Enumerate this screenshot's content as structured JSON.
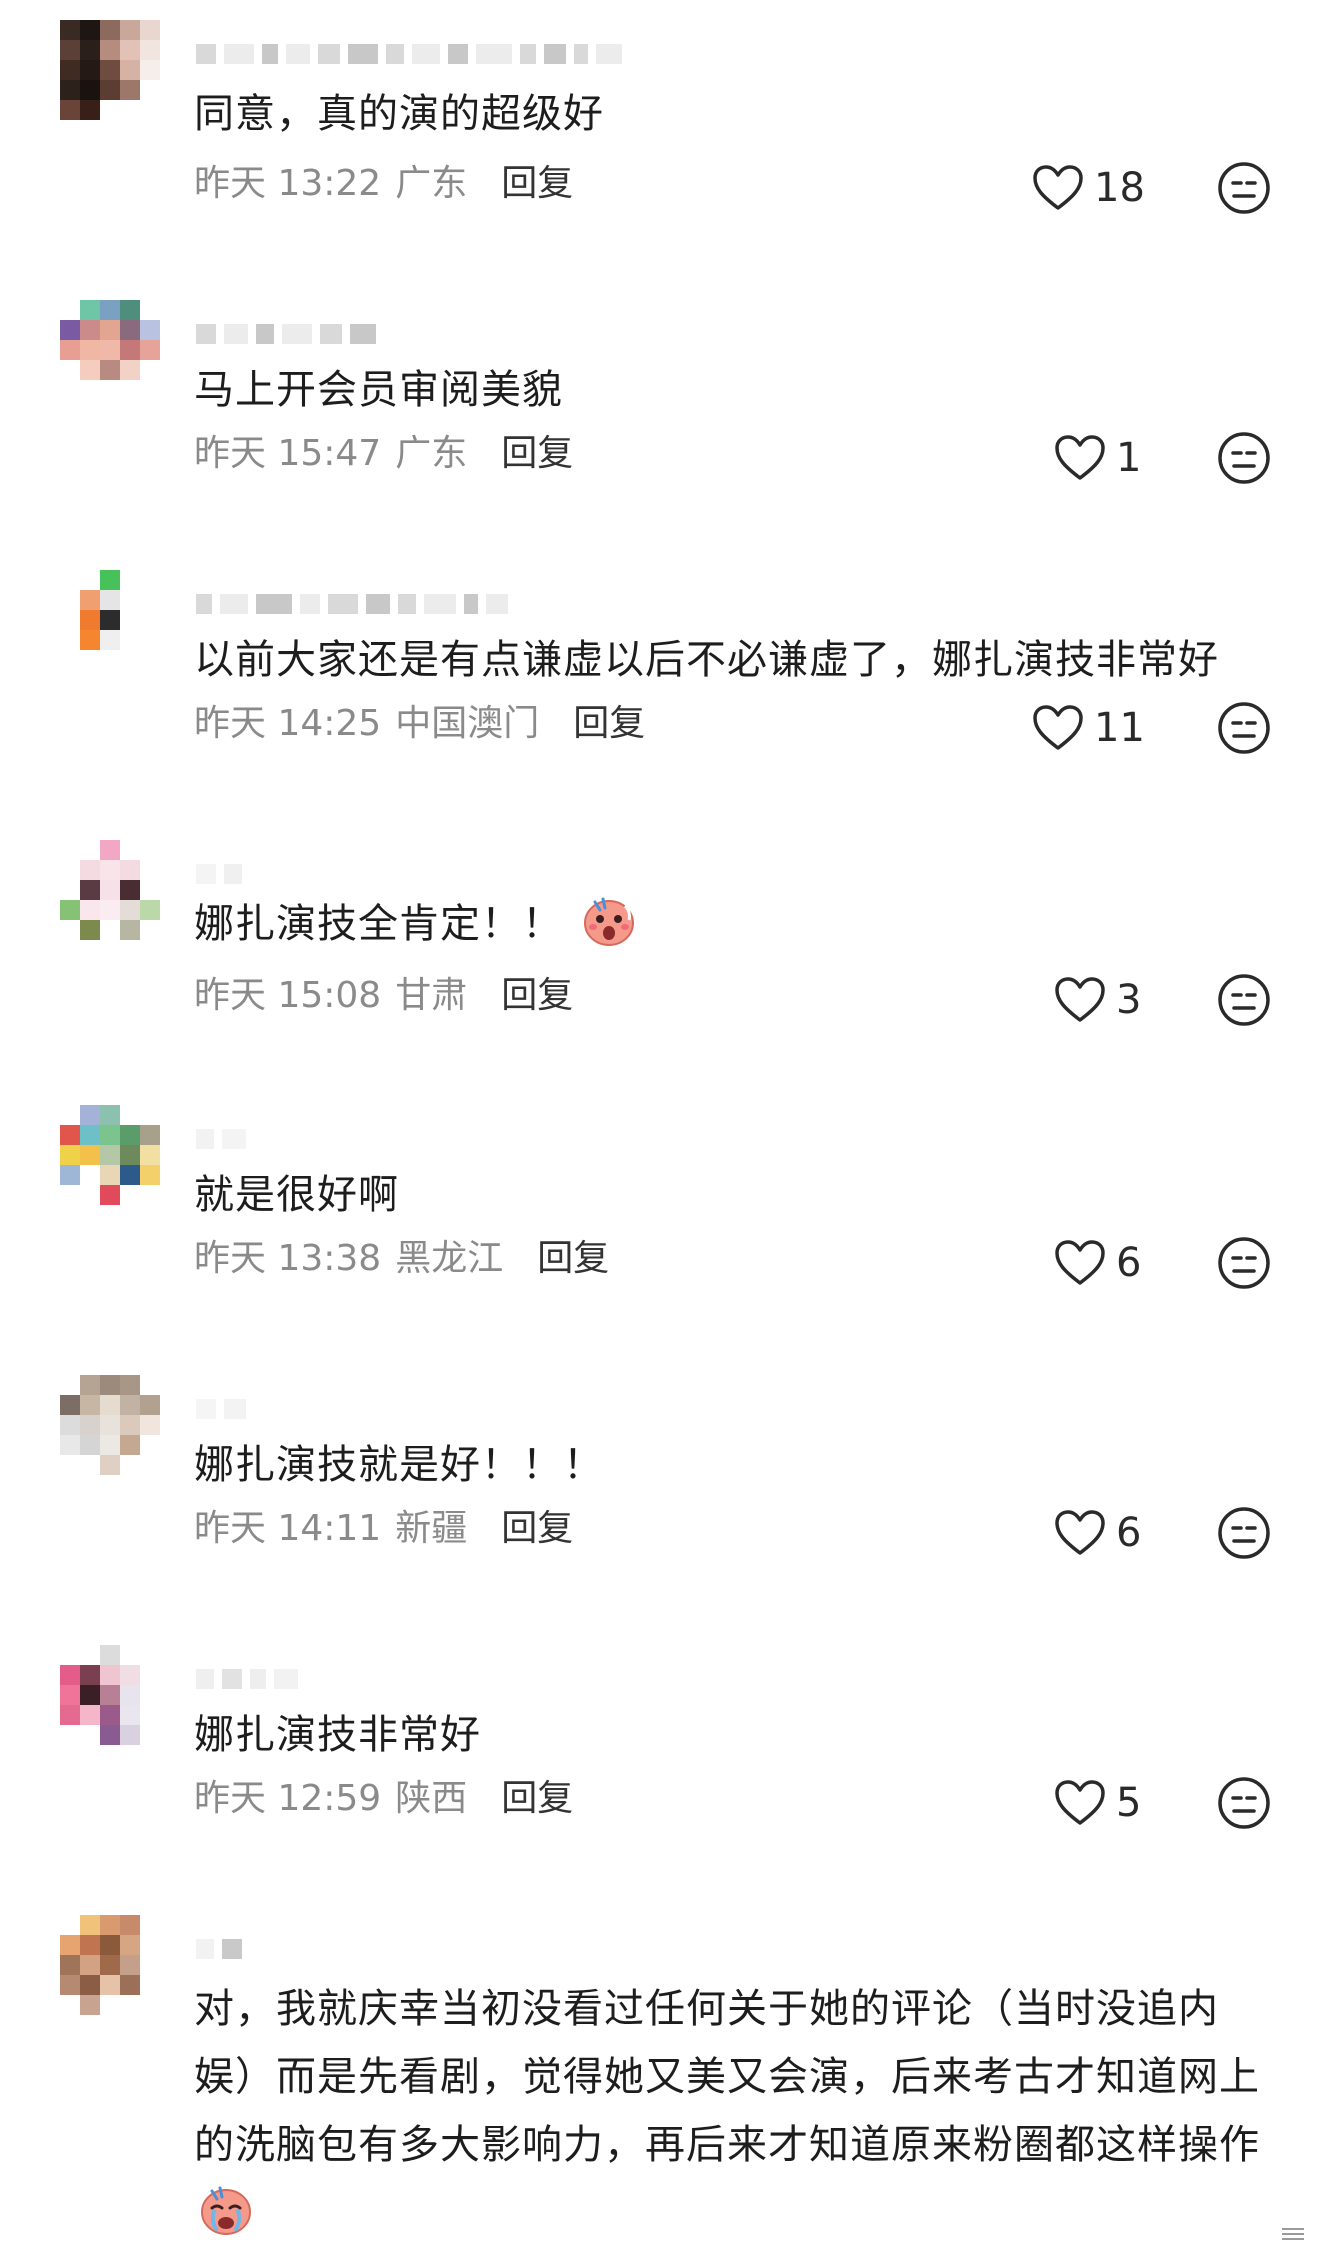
{
  "comments": [
    {
      "text": "同意，真的演的超级好",
      "time": "昨天 13:22",
      "location": "广东",
      "reply": "回复",
      "likes": "18",
      "avatar_colors": [
        "#3a2a24",
        "#1e1612",
        "#8c6b5e",
        "#c9a79b",
        "#e8d6cf",
        "#5a4036",
        "#2b1f1a",
        "#b58c7d",
        "#e2c2b6",
        "#f2e5df",
        "#402b23",
        "#241914",
        "#6e4c40",
        "#d6b2a5",
        "#f6eeea",
        "#2d211c",
        "#1a120f",
        "#5c3d32",
        "#9d7769",
        "#ffffff",
        "#6a4438",
        "#381f18",
        "#ffffff",
        "#ffffff",
        "#ffffff"
      ]
    },
    {
      "text": "马上开会员审阅美貌",
      "time": "昨天 15:47",
      "location": "广东",
      "reply": "回复",
      "likes": "1",
      "avatar_colors": [
        "#ffffff",
        "#6fc6a6",
        "#7aa0c2",
        "#4f8d7d",
        "#ffffff",
        "#7a5aa3",
        "#cc8b8b",
        "#e2a58f",
        "#8a6a7d",
        "#b9c2e0",
        "#e89e93",
        "#f1b7a5",
        "#f0b8a8",
        "#c47878",
        "#e6a39a",
        "#ffffff",
        "#f4cdbf",
        "#b88a82",
        "#f2d2c6",
        "#ffffff",
        "#ffffff",
        "#ffffff",
        "#ffffff",
        "#ffffff",
        "#ffffff"
      ]
    },
    {
      "text": "以前大家还是有点谦虚以后不必谦虚了，娜扎演技非常好",
      "time": "昨天 14:25",
      "location": "中国澳门",
      "reply": "回复",
      "likes": "11",
      "avatar_colors": [
        "#ffffff",
        "#ffffff",
        "#47c25a",
        "#ffffff",
        "#ffffff",
        "#ffffff",
        "#f0a070",
        "#e5e5e5",
        "#ffffff",
        "#ffffff",
        "#ffffff",
        "#f07a2e",
        "#2c2c2c",
        "#ffffff",
        "#ffffff",
        "#ffffff",
        "#f5852f",
        "#efefef",
        "#ffffff",
        "#ffffff",
        "#ffffff",
        "#ffffff",
        "#ffffff",
        "#ffffff",
        "#ffffff"
      ]
    },
    {
      "text": "娜扎演技全肯定！！",
      "time": "昨天 15:08",
      "location": "甘肃",
      "reply": "回复",
      "likes": "3",
      "avatar_colors": [
        "#ffffff",
        "#ffffff",
        "#f2a8c4",
        "#ffffff",
        "#ffffff",
        "#ffffff",
        "#f4dbe2",
        "#f9e4ea",
        "#f4dbe2",
        "#ffffff",
        "#ffffff",
        "#5a3b43",
        "#f7e1e8",
        "#4a2d33",
        "#ffffff",
        "#86c276",
        "#f9e7ed",
        "#fbecf1",
        "#e4ddd7",
        "#bbd8a9",
        "#ffffff",
        "#7c8a4e",
        "#ffffff",
        "#b6b6a2",
        "#ffffff"
      ]
    },
    {
      "text": "就是很好啊",
      "time": "昨天 13:38",
      "location": "黑龙江",
      "reply": "回复",
      "likes": "6",
      "avatar_colors": [
        "#ffffff",
        "#a3b2d6",
        "#8cc1b0",
        "#ffffff",
        "#ffffff",
        "#e0564a",
        "#6ec0c8",
        "#7cc48d",
        "#5a9c6a",
        "#a7a18c",
        "#f0d24a",
        "#f3c14a",
        "#b4c7a6",
        "#6d8a5c",
        "#f2e0a2",
        "#9fb7d6",
        "#ffffff",
        "#e8d6b5",
        "#2c5a8a",
        "#f4d06a",
        "#ffffff",
        "#ffffff",
        "#e14a5a",
        "#ffffff",
        "#ffffff"
      ]
    },
    {
      "text": "娜扎演技就是好！！！",
      "time": "昨天 14:11",
      "location": "新疆",
      "reply": "回复",
      "likes": "6",
      "avatar_colors": [
        "#ffffff",
        "#b5a393",
        "#9c8b7c",
        "#a89787",
        "#ffffff",
        "#7c6e64",
        "#c8b6a5",
        "#e6dbcf",
        "#c1b2a3",
        "#b3a190",
        "#dcdcdc",
        "#d7d2ce",
        "#e8e2dc",
        "#dbcabb",
        "#f0e6dd",
        "#e8e8e8",
        "#d5d5d5",
        "#ece8e4",
        "#c4a892",
        "#ffffff",
        "#ffffff",
        "#ffffff",
        "#e0d0c4",
        "#ffffff",
        "#ffffff"
      ]
    },
    {
      "text": "娜扎演技非常好",
      "time": "昨天 12:59",
      "location": "陕西",
      "reply": "回复",
      "likes": "5",
      "avatar_colors": [
        "#ffffff",
        "#ffffff",
        "#dcdcdc",
        "#ffffff",
        "#ffffff",
        "#e45d8a",
        "#7a4050",
        "#f0c5d2",
        "#f1dde4",
        "#ffffff",
        "#f0739a",
        "#3a1f26",
        "#b88095",
        "#e8e4ee",
        "#ffffff",
        "#e56a8f",
        "#f4b6c8",
        "#9a5a8a",
        "#e9e6f0",
        "#ffffff",
        "#ffffff",
        "#ffffff",
        "#8a5a92",
        "#d9d0e0",
        "#ffffff"
      ]
    },
    {
      "text": "对，我就庆幸当初没看过任何关于她的评论（当时没追内娱）而是先看剧，觉得她又美又会演，后来考古才知道网上的洗脑包有多大影响力，再后来才知道原来粉圈都这样操作",
      "avatar_colors": [
        "#ffffff",
        "#f0c27a",
        "#d89a6e",
        "#c78a6a",
        "#ffffff",
        "#e6a470",
        "#c07550",
        "#8a5a3a",
        "#d6a584",
        "#ffffff",
        "#a07458",
        "#d3a283",
        "#9e6a4a",
        "#c4a08a",
        "#ffffff",
        "#b58a70",
        "#8c5d45",
        "#e6c2a8",
        "#9c7058",
        "#ffffff",
        "#ffffff",
        "#c8a490",
        "#ffffff",
        "#ffffff",
        "#ffffff"
      ]
    }
  ]
}
